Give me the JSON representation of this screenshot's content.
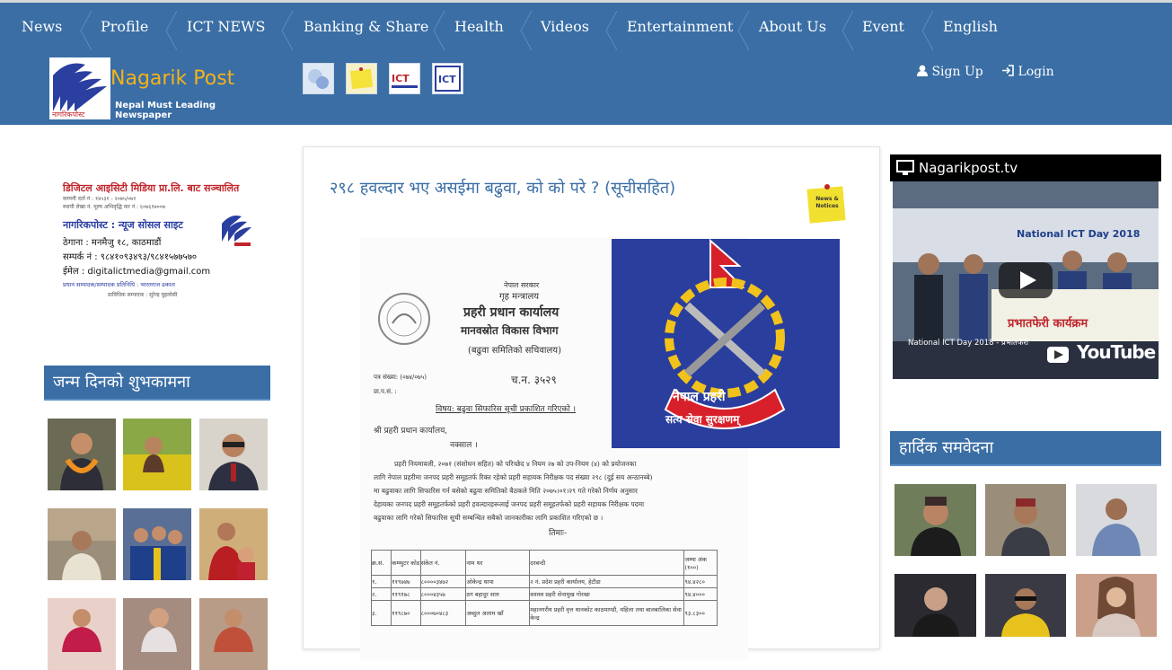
{
  "nav": {
    "items": [
      "News",
      "Profile",
      "ICT NEWS",
      "Banking & Share",
      "Health",
      "Videos",
      "Entertainment",
      "About Us",
      "Event",
      "English"
    ]
  },
  "brand": {
    "title": "Nagarik Post",
    "subtitle": "Nepal Must Leading Newspaper",
    "logo_caption": "नागरिकपोस्ट"
  },
  "header_icons": [
    "chat-bubbles-icon",
    "news-notice-icon",
    "ict-nepal-icon",
    "ict-media-icon"
  ],
  "auth": {
    "signup": "Sign Up",
    "login": "Login"
  },
  "left_ad": {
    "line1": "डिजिटल आइसिटी मिडिया प्रा.लि. बाट सञ्चालित",
    "line2": "कम्पनी दर्ता नं : १४५३१ - २०७५/०७१",
    "line3": "स्थायी लेखा नं. मूल्य अभिवृद्धि कर नं : ६०७६१७००७",
    "line4": "नागरिकपोस्ट : न्यूज सोसल साइट",
    "line5": "ठेगाना : मनमैजु १८, काठमाडौं",
    "line6": "सम्पर्क नं : ९८४१०९३४९३/९८४१५७७५७०",
    "line7": "ईमेल : digitalictmedia@gmail.com",
    "line8": "प्रधान सम्पादक/सम्पादक  प्रतिनिधि : भारतराज ढकाल",
    "line9": "प्राविधिक सम्पादक : सुरेन्द्र घुइलोसी"
  },
  "birthday": {
    "title": "जन्म दिनको शुभकामना"
  },
  "article": {
    "title": "२९८ हवल्दार भए असईमा बढुवा, को को परे ? (सूचीसहित)",
    "badge": "News & Notices",
    "doc": {
      "gov": "नेपाल सरकार",
      "ministry": "गृह मन्त्रालय",
      "office": "प्रहरी प्रधान कार्यालय",
      "dept": "मानवस्रोत विकास विभाग",
      "sec": "(बढुवा समितिको सचिवालय)",
      "ref1": "पत्र संख्या: (०७४/०७५)",
      "ref2": "च.न. ३५२९",
      "ref3": "प्रा.प.सं. :",
      "subject": "विषय: बढुवा सिफारिस सूची प्रकाशित गरिएको ।",
      "to1": "श्री प्रहरी प्रधान कार्यालय,",
      "to2": "नक्साल ।",
      "body1": "प्रहरी नियमावली, २०७१ (संशोधन सहित) को परिच्छेद ४ नियम २७ को उप-नियम (४) को प्रयोजनका",
      "body2": "लागि नेपाल प्रहरीमा जनपद प्रहरी समूहतर्फ रिक्त रहेको प्रहरी सहायक निरीक्षक पद संख्या २९८ (दुई सय अन्ठानब्बे)",
      "body3": "मा बढुवाका लागि सिफारिस गर्न बसेको बढुवा समितिको बैठकले मिति २०७५।०१।२९ गते गरेको निर्णय अनुसार",
      "body4": "देहायका जनपद प्रहरी समूहतर्फको प्रहरी हवल्दारहरूलाई जनपद प्रहरी समूहतर्फको प्रहरी सहायक निरीक्षक पदमा",
      "body5": "बढुवाका लागि गरेको सिफारिस सूची सम्बन्धित सबैको जानकारीका लागि प्रकाशित गरिएको छ ।",
      "annex": "तिमाः-",
      "table_headers": [
        "क्र.सं.",
        "कम्प्युटर कोड",
        "संकेत नं.",
        "नाम थर",
        "दरबन्दी",
        "जम्मा अंक (१००)"
      ],
      "table_rows": [
        [
          "१.",
          "११९७४७",
          "८००००३४७२",
          "ओकेन्द्र थापा",
          "२ नं. प्रदेश प्रहरी कार्यालय, हेटौडा",
          "९४.४२८०"
        ],
        [
          "२.",
          "११९१७८",
          "८०००४३५७",
          "ठग बहादुर सारु",
          "सशस्त्र प्रहरी सेनामुख गोरखा",
          "९४.४०००"
        ],
        [
          "३.",
          "११९८७०",
          "८०००७०४८३",
          "अब्दुल अलाम खाँ",
          "महानगरीय प्रहरी वृत्त थानकोट काठमाण्डौ, महिला तथा बालबालिका सेवा केन्द्र",
          "९३.८३००"
        ]
      ]
    },
    "emblem": {
      "line1": "नेपाल प्रहरी",
      "line2": "सत्य सेवा सुरक्षणम्"
    }
  },
  "tv": {
    "title": "Nagarikpost.tv",
    "video_caption": "National ICT Day 2018 - प्रभातफेरी",
    "banner": "प्रभातफेरी कार्यक्रम",
    "banner_top": "National ICT Day 2018",
    "youtube": "YouTube"
  },
  "condolence": {
    "title": "हार्दिक समवेदना"
  }
}
